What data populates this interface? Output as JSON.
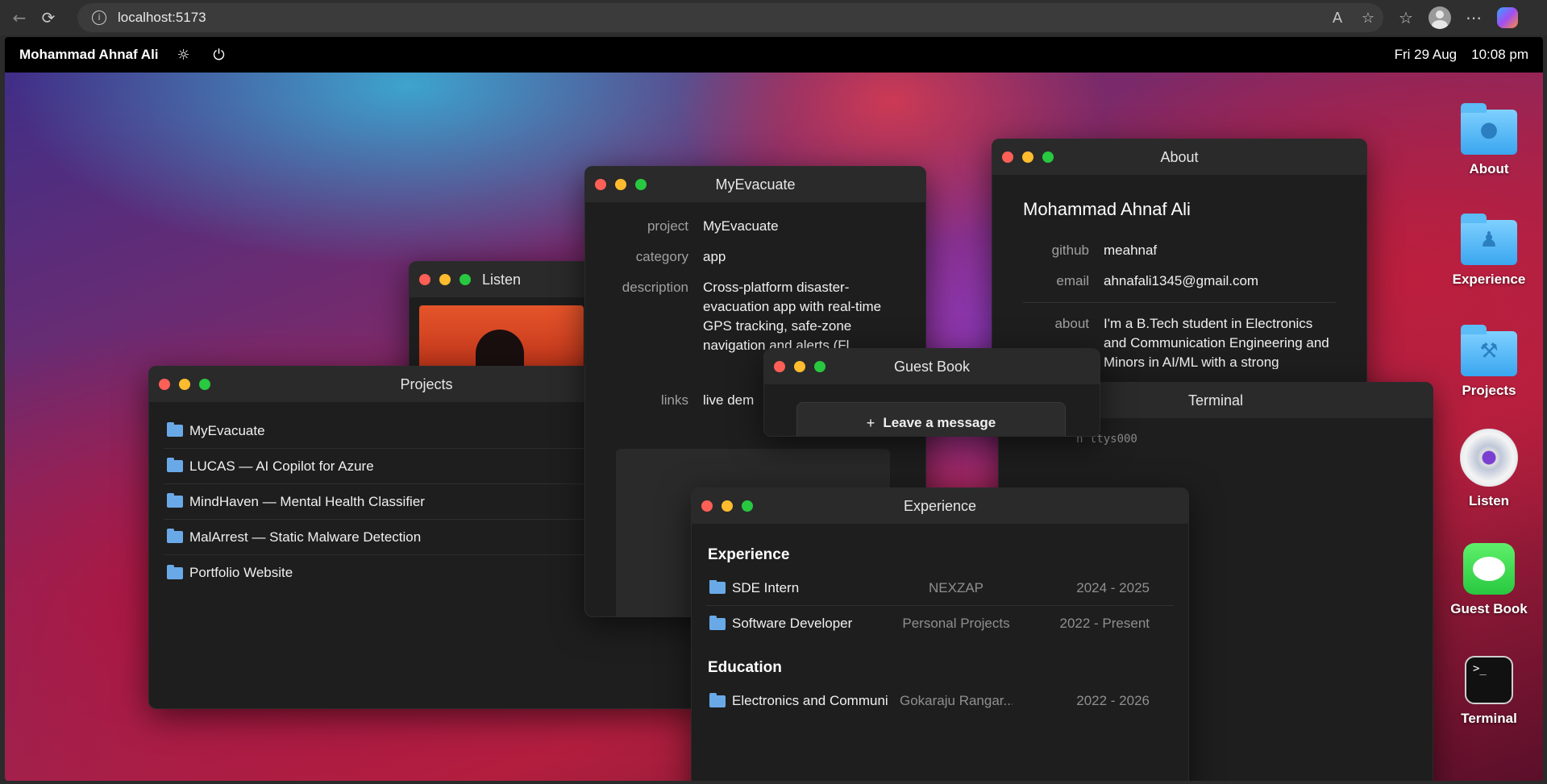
{
  "browser": {
    "url": "localhost:5173",
    "back_icon": "arrow-left-icon",
    "reload_icon": "reload-icon"
  },
  "menubar": {
    "owner": "Mohammad Ahnaf Ali",
    "date": "Fri 29 Aug",
    "time": "10:08 pm"
  },
  "windows": {
    "projects": {
      "title": "Projects",
      "items": [
        "MyEvacuate",
        "LUCAS — AI Copilot for Azure",
        "MindHaven — Mental Health Classifier",
        "MalArrest — Static Malware Detection",
        "Portfolio Website"
      ]
    },
    "listen": {
      "title": "Listen"
    },
    "evac": {
      "title": "MyEvacuate",
      "rows": [
        {
          "k": "project",
          "v": "MyEvacuate"
        },
        {
          "k": "category",
          "v": "app"
        },
        {
          "k": "description",
          "v": "Cross-platform disaster-evacuation app with real-time GPS tracking, safe-zone navigation and alerts (Fl"
        },
        {
          "k": "links",
          "v": "live dem"
        }
      ]
    },
    "about": {
      "title": "About",
      "name": "Mohammad Ahnaf Ali",
      "github_label": "github",
      "github": "meahnaf",
      "email_label": "email",
      "email": "ahnafali1345@gmail.com",
      "about_label": "about",
      "about": "I'm a B.Tech student in Electronics and Communication Engineering and Minors in AI/ML with a strong"
    },
    "terminal": {
      "title": "Terminal",
      "line": "n ttys000"
    },
    "guest": {
      "title": "Guest Book",
      "button": "Leave a message",
      "plus": "+"
    },
    "experience": {
      "title": "Experience",
      "exp_heading": "Experience",
      "edu_heading": "Education",
      "experience": [
        {
          "role": "SDE Intern",
          "org": "NEXZAP",
          "dates": "2024 - 2025"
        },
        {
          "role": "Software Developer",
          "org": "Personal Projects",
          "dates": "2022 - Present"
        }
      ],
      "education": [
        {
          "role": "Electronics and Communi",
          "org": "Gokaraju Rangar...",
          "dates": "2022 - 2026"
        }
      ]
    }
  },
  "desktop_icons": [
    "About",
    "Experience",
    "Projects",
    "Listen",
    "Guest Book",
    "Terminal"
  ],
  "colors": {
    "close": "#fe5f57",
    "minimize": "#febc2e",
    "zoom": "#28c840",
    "folder": "#6aa9e8"
  }
}
